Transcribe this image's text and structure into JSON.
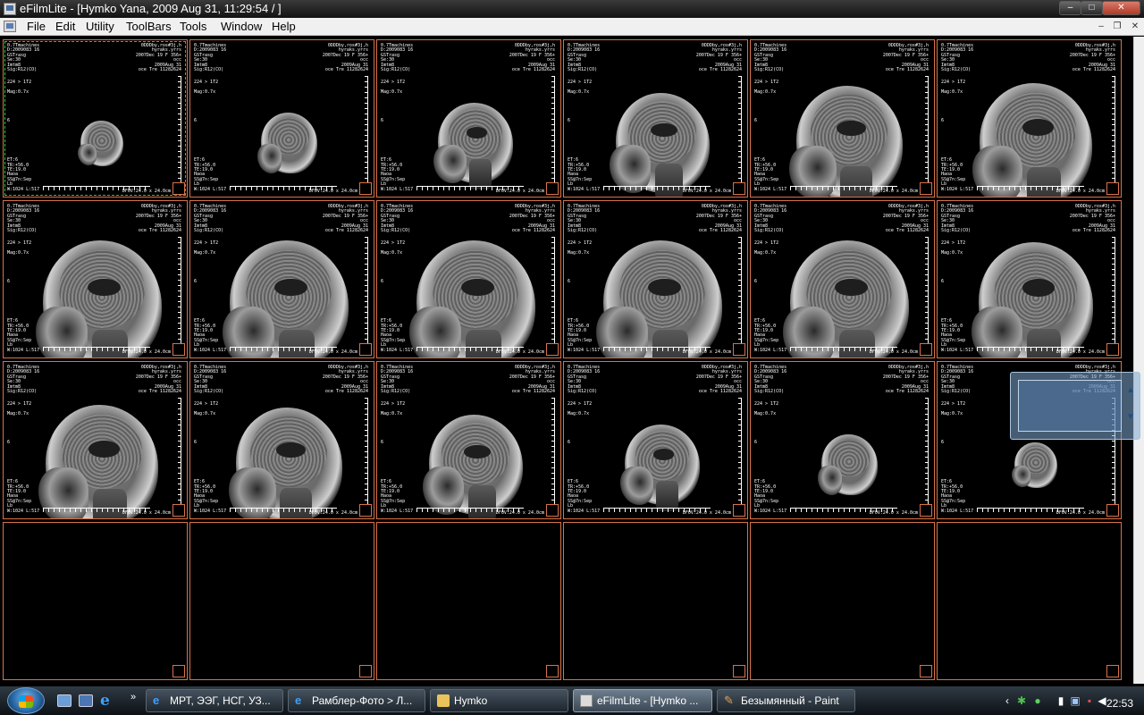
{
  "window": {
    "title": "eFilmLite - [Hymko Yana, 2009 Aug 31, 11:29:54  /  ]"
  },
  "menu": [
    "File",
    "Edit",
    "Utility",
    "ToolBars",
    "Tools",
    "Window",
    "Help"
  ],
  "overlay": {
    "top_left": "0.7Tmachines\nD:2009083 16\nGSTrasg\nSe:30\nImtm8\nSig:R12(CO)",
    "top_right": "0DDDby,ros#3j,h\nhyraks.yrrs\n2007Dec 19 F 356+\nocc\n2009Aug 31\noce Tre 11282624",
    "mid": "224 > 1T2\n\nMag:0.7x",
    "six": "6",
    "bottom_left": "ET:6\nTR:+56.0\nTE:19.0\nHaoa\nSS@7n:Sep\nLb\nW:1024 L:517",
    "bottom_right": "DFOV:24.0 x 24.0cm"
  },
  "taskbar": {
    "tasks": [
      {
        "label": "МРТ, ЭЭГ, НСГ, УЗ...",
        "icon": "ie-icon",
        "active": false
      },
      {
        "label": "Рамблер-Фото > Л...",
        "icon": "ie-icon",
        "active": false
      },
      {
        "label": "Hymko",
        "icon": "folder-icon",
        "active": false
      },
      {
        "label": "eFilmLite - [Hymko ...",
        "icon": "efilm-icon",
        "active": true
      },
      {
        "label": "Безымянный - Paint",
        "icon": "paint-icon",
        "active": false
      }
    ],
    "quicklaunch_more": "»",
    "clock": "22:53"
  }
}
